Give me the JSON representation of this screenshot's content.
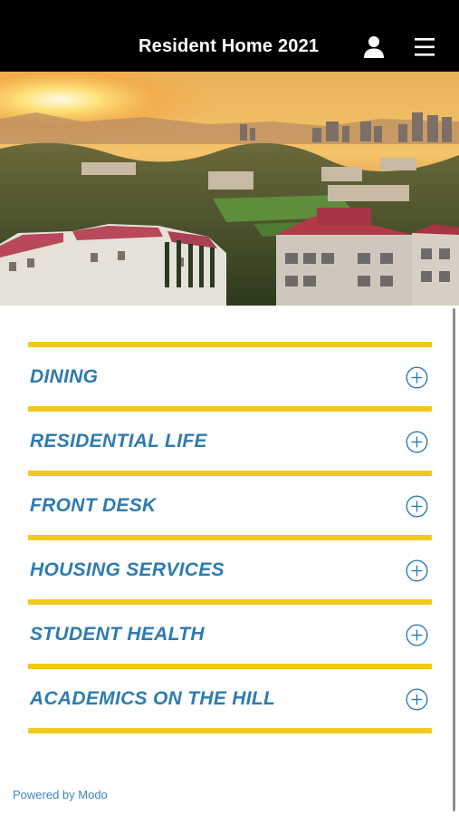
{
  "header": {
    "title": "Resident Home 2021",
    "user_icon": "user-icon",
    "menu_icon": "hamburger-menu-icon"
  },
  "hero": {
    "description_icon": "campus-sunset-photo"
  },
  "menu": {
    "items": [
      {
        "label": "DINING",
        "icon": "plus-circle-icon"
      },
      {
        "label": "RESIDENTIAL LIFE",
        "icon": "plus-circle-icon"
      },
      {
        "label": "FRONT DESK",
        "icon": "plus-circle-icon"
      },
      {
        "label": "HOUSING SERVICES",
        "icon": "plus-circle-icon"
      },
      {
        "label": "STUDENT HEALTH",
        "icon": "plus-circle-icon"
      },
      {
        "label": "ACADEMICS ON THE HILL",
        "icon": "plus-circle-icon"
      }
    ]
  },
  "footer": {
    "text": "Powered by Modo"
  },
  "colors": {
    "header_bg": "#000000",
    "accent_yellow": "#f2c81d",
    "label_blue": "#2e7bb1",
    "footer_blue": "#3b86c0"
  }
}
